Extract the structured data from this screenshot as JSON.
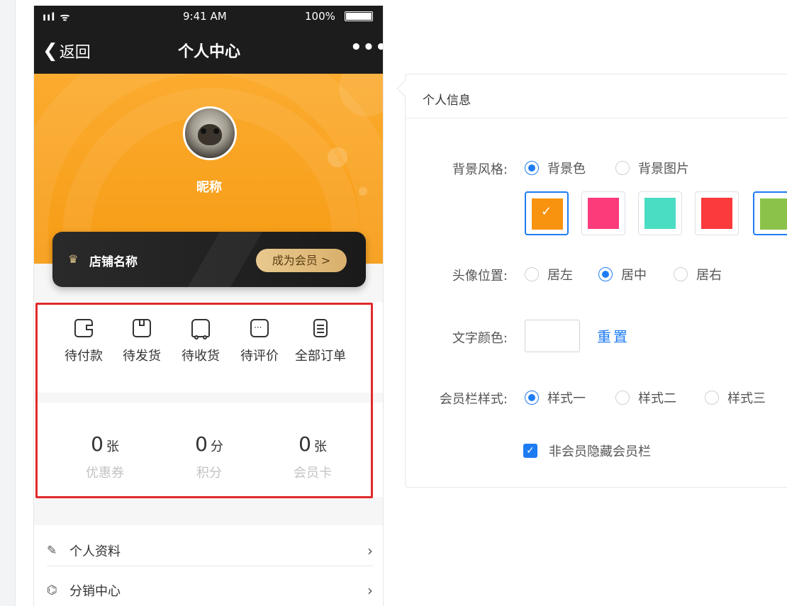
{
  "status_bar": {
    "signal": "ııl ᯤ",
    "time": "9:41 AM",
    "battery": "100%"
  },
  "nav": {
    "back_label": "返回",
    "title": "个人中心",
    "more": "•••"
  },
  "profile": {
    "nickname": "昵称"
  },
  "member_bar": {
    "shop_name": "店铺名称",
    "join_label": "成为会员  >"
  },
  "orders": [
    {
      "label": "待付款",
      "icon": "wallet-icon"
    },
    {
      "label": "待发货",
      "icon": "package-icon"
    },
    {
      "label": "待收货",
      "icon": "truck-icon"
    },
    {
      "label": "待评价",
      "icon": "comment-icon"
    },
    {
      "label": "全部订单",
      "icon": "clipboard-icon"
    }
  ],
  "stats": [
    {
      "value": "0",
      "unit": "张",
      "label": "优惠券"
    },
    {
      "value": "0",
      "unit": "分",
      "label": "积分"
    },
    {
      "value": "0",
      "unit": "张",
      "label": "会员卡"
    }
  ],
  "menu": [
    {
      "label": "个人资料",
      "icon": "edit-icon"
    },
    {
      "label": "分销中心",
      "icon": "distribution-icon"
    }
  ],
  "panel": {
    "title": "个人信息",
    "bg_style": {
      "label": "背景风格:",
      "options": [
        "背景色",
        "背景图片"
      ],
      "selected": 0
    },
    "swatches": [
      "#f7930f",
      "#fb3b7a",
      "#4bddc3",
      "#fb3a3c",
      "#8bc34a"
    ],
    "selected_swatch": 0,
    "avatar_pos": {
      "label": "头像位置:",
      "options": [
        "居左",
        "居中",
        "居右"
      ],
      "selected": 1
    },
    "text_color": {
      "label": "文字颜色:",
      "reset": "重置"
    },
    "member_style": {
      "label": "会员栏样式:",
      "options": [
        "样式一",
        "样式二",
        "样式三"
      ],
      "selected": 0
    },
    "hide_member": {
      "label": "非会员隐藏会员栏",
      "checked": true
    }
  }
}
